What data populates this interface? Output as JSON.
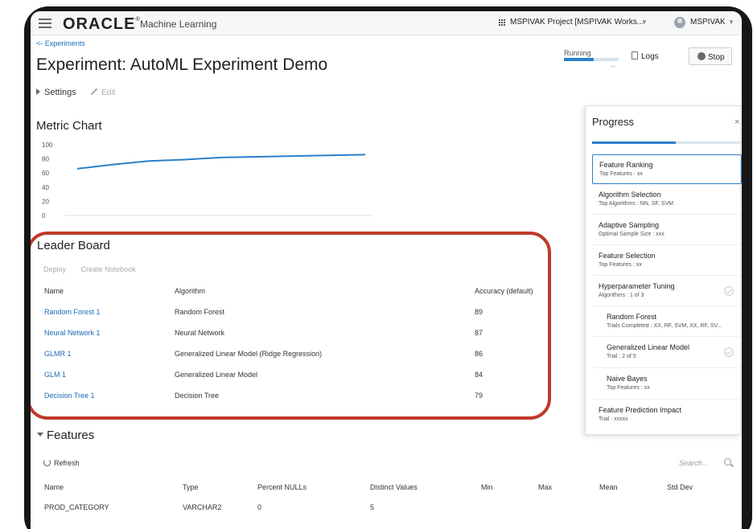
{
  "header": {
    "brand": "ORACLE",
    "brand_reg": "®",
    "product": "Machine Learning",
    "project_label": "MSPIVAK Project [MSPIVAK Works...",
    "user_label": "MSPIVAK"
  },
  "experiment": {
    "back_link": "<- Experiments",
    "title": "Experiment: AutoML Experiment Demo",
    "status_label": "Running",
    "status_dots": "...",
    "status_progress": 0.55,
    "logs_label": "Logs",
    "stop_label": "Stop",
    "settings_label": "Settings",
    "edit_label": "Edit"
  },
  "metric_chart": {
    "title": "Metric Chart"
  },
  "chart_data": {
    "type": "line",
    "title": "",
    "xlabel": "",
    "ylabel": "",
    "ylim": [
      0,
      100
    ],
    "yticks": [
      "100",
      "80",
      "60",
      "40",
      "20",
      "0"
    ],
    "x": [
      1,
      2,
      3,
      4,
      5,
      6,
      7,
      8,
      9
    ],
    "series": [
      {
        "values": [
          66,
          72,
          77,
          79,
          82,
          83,
          84,
          85,
          86
        ],
        "color": "#2a7fc9"
      }
    ],
    "grid": false
  },
  "leader_board": {
    "title": "Leader Board",
    "deploy_label": "Deploy",
    "create_notebook_label": "Create Notebook",
    "columns": [
      "Name",
      "Algorithm",
      "Accuracy (default)"
    ],
    "rows": [
      {
        "name": "Random Forest 1",
        "algorithm": "Random Forest",
        "accuracy": "89"
      },
      {
        "name": "Neural Network 1",
        "algorithm": "Neural Network",
        "accuracy": "87"
      },
      {
        "name": "GLMR 1",
        "algorithm": "Generalized Linear Model (Ridge Regression)",
        "accuracy": "86"
      },
      {
        "name": "GLM 1",
        "algorithm": "Generalized Linear Model",
        "accuracy": "84"
      },
      {
        "name": "Decision Tree 1",
        "algorithm": "Decision Tree",
        "accuracy": "79"
      }
    ]
  },
  "features": {
    "title": "Features",
    "refresh_label": "Refresh",
    "search_placeholder": "Search...",
    "columns": [
      "Name",
      "Type",
      "Percent NULLs",
      "Distinct Values",
      "Min",
      "Max",
      "Mean",
      "Std Dev"
    ],
    "rows": [
      [
        "PROD_CATEGORY",
        "VARCHAR2",
        "0",
        "5",
        "",
        "",
        "",
        ""
      ]
    ]
  },
  "progress": {
    "title": "Progress",
    "close": "×",
    "fraction": 0.56,
    "steps": [
      {
        "title": "Feature Ranking",
        "subtitle": "Top Features : xx",
        "active": true,
        "done": false,
        "sub": false
      },
      {
        "title": "Algorithm Selection",
        "subtitle": "Top Algorithms : NN, SF, SVM",
        "active": false,
        "done": false,
        "sub": false
      },
      {
        "title": "Adaptive Sampling",
        "subtitle": "Optimal Sample Size : xxx",
        "active": false,
        "done": false,
        "sub": false
      },
      {
        "title": "Feature Selection",
        "subtitle": "Top Features : xx",
        "active": false,
        "done": false,
        "sub": false
      },
      {
        "title": "Hyperparameter Tuning",
        "subtitle": "Algorithms : 1 of 3",
        "active": false,
        "done": true,
        "sub": false
      },
      {
        "title": "Random Forest",
        "subtitle": "Trials Completed : XX, RF, SVM, XX, RF, SV...",
        "active": false,
        "done": false,
        "sub": true
      },
      {
        "title": "Generalized Linear Model",
        "subtitle": "Trial : 2 of 5",
        "active": false,
        "done": true,
        "sub": true
      },
      {
        "title": "Naive Bayes",
        "subtitle": "Top Features : xx",
        "active": false,
        "done": false,
        "sub": true
      },
      {
        "title": "Feature Prediction Impact",
        "subtitle": "Trial : xxxxx",
        "active": false,
        "done": false,
        "sub": false
      }
    ]
  }
}
